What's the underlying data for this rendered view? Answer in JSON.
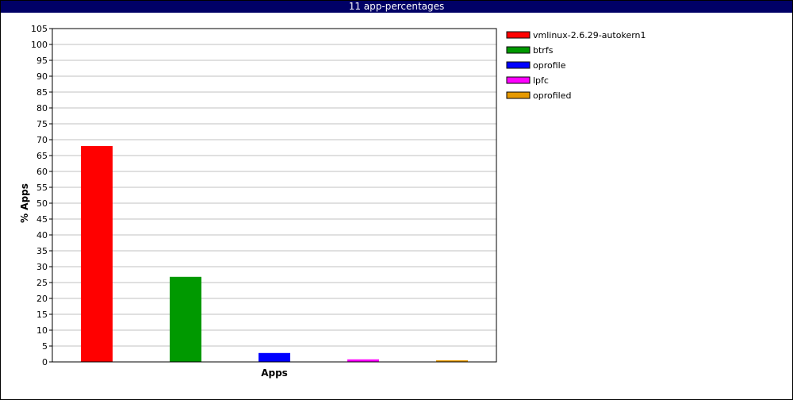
{
  "window": {
    "title": "11 app-percentages"
  },
  "colors": {
    "title_bar": "#000066"
  },
  "chart_data": {
    "type": "bar",
    "title": "11 app-percentages",
    "xlabel": "Apps",
    "ylabel": "% Apps",
    "ylim": [
      0,
      105
    ],
    "y_ticks": [
      0,
      5,
      10,
      15,
      20,
      25,
      30,
      35,
      40,
      45,
      50,
      55,
      60,
      65,
      70,
      75,
      80,
      85,
      90,
      95,
      100,
      105
    ],
    "grid": true,
    "legend_position": "right",
    "series": [
      {
        "name": "vmlinux-2.6.29-autokern1",
        "value": 68.0,
        "color": "#ff0000"
      },
      {
        "name": "btrfs",
        "value": 26.8,
        "color": "#009900"
      },
      {
        "name": "oprofile",
        "value": 2.8,
        "color": "#0000ff"
      },
      {
        "name": "lpfc",
        "value": 0.8,
        "color": "#ff00ff"
      },
      {
        "name": "oprofiled",
        "value": 0.5,
        "color": "#e69900"
      }
    ]
  }
}
